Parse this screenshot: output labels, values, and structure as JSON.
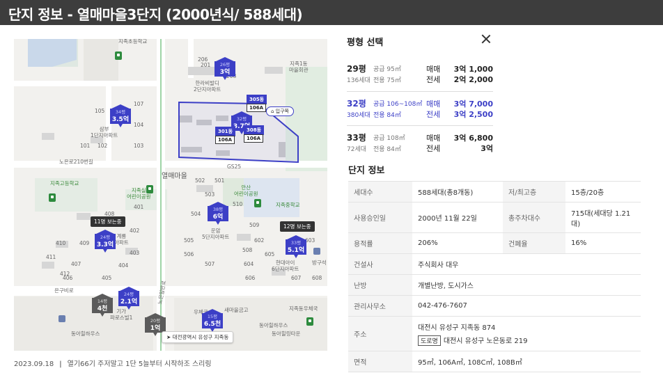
{
  "header": {
    "title": "단지 정보 - 열매마을3단지 (2000년식/ 588세대)"
  },
  "map": {
    "labels": {
      "school_top": "지족초등학교",
      "apt_hanri": "한라비발디\n2단지아파트",
      "apt_samboo": "삼부\n1단지아파트",
      "apt_1jiok": "지족1동\n마을회관",
      "road_north": "노은로210번길",
      "village": "열매마을",
      "gs25": "GS25",
      "school_high": "지족고등학교",
      "park_jijok": "지족실\n어린이공원",
      "park_ansan": "안산\n어린이공원",
      "school_mid": "지족중학교",
      "apt_unam": "운암\n5단지아파트",
      "apt_gyeryong": "계룡\n아파트",
      "apt_hyundai": "현대아이\n6단지아파트",
      "road_east": "방구석",
      "road_noeun": "은구비로",
      "apt_kiga": "기가\n파로스빌1",
      "apt_dongah": "동아힐하우스",
      "post": "지족동우체국",
      "bank": "새마을금고",
      "apt_dongah2": "동아힐하우스",
      "apt_hilltown": "동아힐링타운",
      "road_ramp": "노은일반로",
      "store": "우체국",
      "dong_num_206": "206",
      "dong_num_201": "201",
      "dong_num_208": "208",
      "dong_num_101": "101",
      "dong_num_102": "102",
      "dong_num_103": "103",
      "dong_num_107": "107",
      "dong_num_104": "104",
      "dong_num_501": "501",
      "dong_num_502": "502",
      "dong_num_503": "503",
      "dong_num_504": "504",
      "dong_num_505": "505",
      "dong_num_506": "506",
      "dong_num_507": "507",
      "dong_num_508": "508",
      "dong_num_509": "509",
      "dong_num_510": "510",
      "dong_num_602": "602",
      "dong_num_603": "603",
      "dong_num_604": "604",
      "dong_num_605": "605",
      "dong_num_606": "606",
      "dong_num_607": "607",
      "dong_num_608": "608",
      "dong_num_401": "401",
      "dong_num_402": "402",
      "dong_num_403": "403",
      "dong_num_404": "404",
      "dong_num_405": "405",
      "dong_num_406": "406",
      "dong_num_407": "407",
      "dong_num_408": "408",
      "dong_num_409": "409",
      "dong_num_410": "410",
      "dong_num_411": "411",
      "dong_num_412": "412",
      "dong_num_105": "105",
      "dong_num_106": "106"
    },
    "pins": [
      {
        "py": "26평",
        "price": "3억",
        "color": "blue"
      },
      {
        "py": "34평",
        "price": "3.5억",
        "color": "blue"
      },
      {
        "py": "30평",
        "price": "106A",
        "color": "blue"
      },
      {
        "py": "32평",
        "price": "3.7억",
        "color": "blue"
      },
      {
        "py": "38평",
        "price": "6억",
        "color": "blue"
      },
      {
        "py": "24평",
        "price": "3.3억",
        "color": "blue"
      },
      {
        "py": "33평",
        "price": "5.1억",
        "color": "blue"
      },
      {
        "py": "14평",
        "price": "4천",
        "color": "gray"
      },
      {
        "py": "24평",
        "price": "2.1억",
        "color": "blue"
      },
      {
        "py": "20평",
        "price": "1억",
        "color": "gray"
      },
      {
        "py": "15평",
        "price": "6.5천",
        "color": "blue"
      }
    ],
    "dong_tags": {
      "d305": "305동",
      "d301": "301동",
      "d308": "308동",
      "a1": "106A",
      "a2": "106A",
      "a3": "106A"
    },
    "entrance": "입구쪽",
    "view_tag_11": "11명 보는중",
    "view_tag_12": "12명 보는중",
    "address_chip": "대전광역시 유성구 지족동"
  },
  "footnote": {
    "date": "2023.09.18",
    "text": "열기66기 주저말고 1단 5늘부터 시작하조 스리링"
  },
  "panel": {
    "title": "평형 선택",
    "types": [
      {
        "name": "29평",
        "units": "136세대",
        "supply": "공급 95㎡",
        "exclusive": "전용 75㎡",
        "t1": "매매",
        "p1": "3억 1,000",
        "t2": "전세",
        "p2": "2억 2,000",
        "active": false
      },
      {
        "name": "32평",
        "units": "380세대",
        "supply": "공급 106~108㎡",
        "exclusive": "전용 84㎡",
        "t1": "매매",
        "p1": "3억 7,000",
        "t2": "전세",
        "p2": "3억 2,500",
        "active": true
      },
      {
        "name": "33평",
        "units": "72세대",
        "supply": "공급 108㎡",
        "exclusive": "전용 84㎡",
        "t1": "매매",
        "p1": "3억 6,800",
        "t2": "전세",
        "p2": "3억",
        "active": false
      }
    ],
    "info_title": "단지 정보",
    "info": {
      "units_k": "세대수",
      "units_v": "588세대(총8개동)",
      "floors_k": "저/최고층",
      "floors_v": "15층/20층",
      "approval_k": "사용승인일",
      "approval_v": "2000년 11월 22일",
      "parking_k": "총주차대수",
      "parking_v": "715대(세대당 1.21대)",
      "far_k": "용적률",
      "far_v": "206%",
      "bcr_k": "건폐율",
      "bcr_v": "16%",
      "builder_k": "건설사",
      "builder_v": "주식회사 대우",
      "heating_k": "난방",
      "heating_v": "개별난방, 도시가스",
      "office_k": "관리사무소",
      "office_v": "042-476-7607",
      "address_k": "주소",
      "address_v1": "대전시 유성구 지족동 874",
      "road_badge": "도로명",
      "address_v2": "대전시 유성구 노은동로 219",
      "area_k": "면적",
      "area_v": "95㎡, 106A㎡, 108C㎡, 108B㎡"
    }
  },
  "colors": {
    "accent": "#3c3fc6",
    "header_bg": "#3d3d3d",
    "gray_pin": "#5b5b5b"
  }
}
